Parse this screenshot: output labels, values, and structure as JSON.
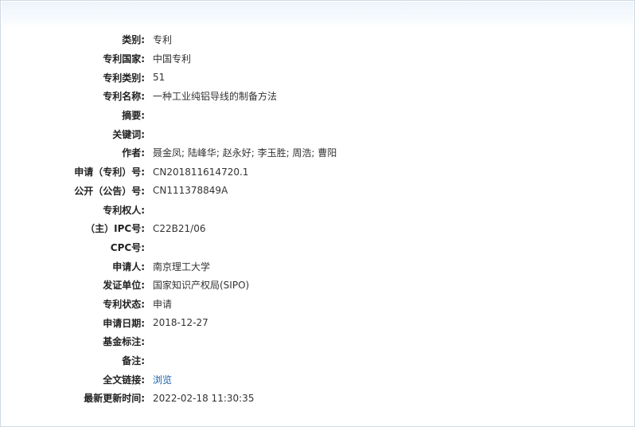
{
  "fields": [
    {
      "label": "类别:",
      "value": "专利"
    },
    {
      "label": "专利国家:",
      "value": "中国专利"
    },
    {
      "label": "专利类别:",
      "value": "51"
    },
    {
      "label": "专利名称:",
      "value": "一种工业纯铝导线的制备方法"
    },
    {
      "label": "摘要:",
      "value": ""
    },
    {
      "label": "关键词:",
      "value": ""
    },
    {
      "label": "作者:",
      "value": "聂金凤; 陆峰华; 赵永好; 李玉胜; 周浩; 曹阳"
    },
    {
      "label": "申请（专利）号:",
      "value": "CN201811614720.1"
    },
    {
      "label": "公开（公告）号:",
      "value": "CN111378849A"
    },
    {
      "label": "专利权人:",
      "value": ""
    },
    {
      "label": "（主）IPC号:",
      "value": "C22B21/06"
    },
    {
      "label": "CPC号:",
      "value": ""
    },
    {
      "label": "申请人:",
      "value": "南京理工大学"
    },
    {
      "label": "发证单位:",
      "value": "国家知识产权局(SIPO)"
    },
    {
      "label": "专利状态:",
      "value": "申请"
    },
    {
      "label": "申请日期:",
      "value": "2018-12-27"
    },
    {
      "label": "基金标注:",
      "value": ""
    },
    {
      "label": "备注:",
      "value": ""
    },
    {
      "label": "全文链接:",
      "value": "浏览"
    },
    {
      "label": "最新更新时间:",
      "value": "2022-02-18 11:30:35"
    }
  ],
  "colors": {
    "link": "#1a5ea8",
    "border": "#cfd8e3"
  }
}
